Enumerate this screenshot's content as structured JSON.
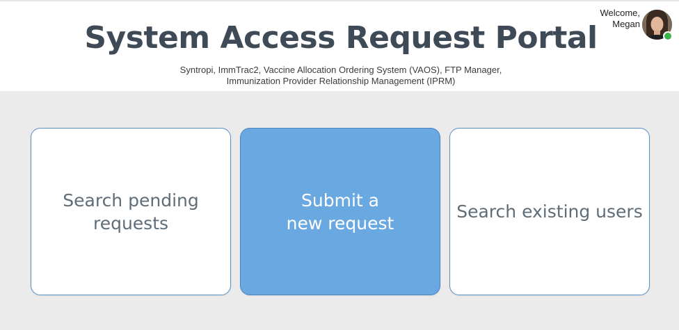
{
  "header": {
    "title": "System Access Request Portal",
    "subtitle_line1": "Syntropi, ImmTrac2, Vaccine Allocation Ordering System (VAOS), FTP Manager,",
    "subtitle_line2": "Immunization Provider Relationship Management (IPRM)"
  },
  "user": {
    "welcome_line1": "Welcome,",
    "welcome_line2": "Megan",
    "status": "online",
    "status_color": "#3bb44a"
  },
  "actions": [
    {
      "label": "Search pending\nrequests",
      "style": "secondary"
    },
    {
      "label": "Submit a\nnew request",
      "style": "primary",
      "accent": "#6aa8e2"
    },
    {
      "label": "Search existing users",
      "style": "secondary"
    }
  ]
}
